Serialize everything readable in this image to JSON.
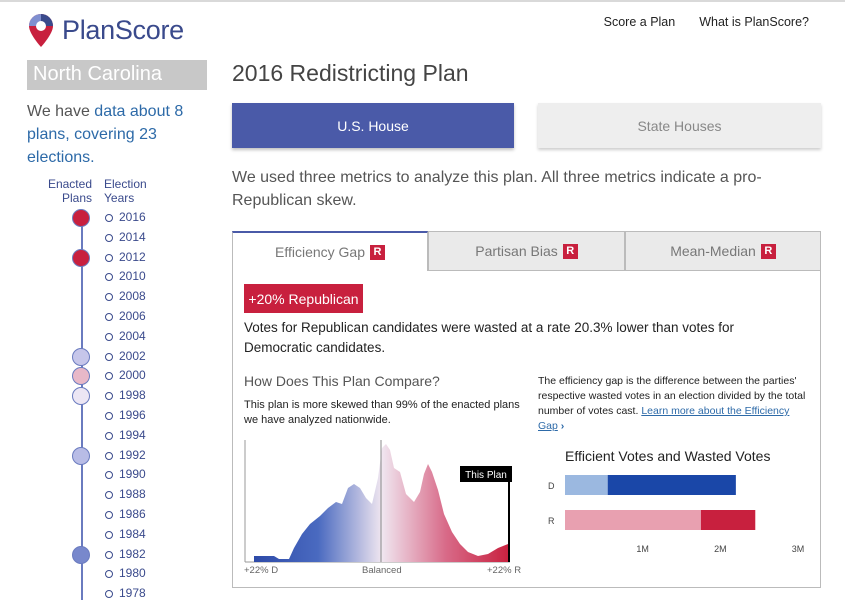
{
  "header": {
    "brand": "PlanScore",
    "nav": [
      "Score a Plan",
      "What is PlanScore?"
    ]
  },
  "sidebar": {
    "state": "North Carolina",
    "summary": {
      "prefix": "We have ",
      "link": "data about 8 plans, covering 23 elections.",
      "suffix": ""
    },
    "col_enacted": [
      "Enacted",
      "Plans"
    ],
    "col_years": [
      "Election",
      "Years"
    ],
    "years": [
      "2016",
      "2014",
      "2012",
      "2010",
      "2008",
      "2006",
      "2004",
      "2002",
      "2000",
      "1998",
      "1996",
      "1994",
      "1992",
      "1990",
      "1988",
      "1986",
      "1984",
      "1982",
      "1980",
      "1978"
    ],
    "enacted": [
      {
        "year": "2016",
        "color": "#c8203e"
      },
      {
        "year": "2012",
        "color": "#c8203e"
      },
      {
        "year": "2002",
        "color": "#c6c6ea"
      },
      {
        "year": "2000",
        "color": "#e8b8c8"
      },
      {
        "year": "1998",
        "color": "#ece6f4"
      },
      {
        "year": "1992",
        "color": "#b8bce6"
      },
      {
        "year": "1982",
        "color": "#7888cc"
      }
    ]
  },
  "main": {
    "title": "2016 Redistricting Plan",
    "buttons": {
      "house": "U.S. House",
      "state": "State Houses"
    },
    "intro": "We used three metrics to analyze this plan. All three metrics indicate a pro-Republican skew.",
    "tabs": [
      {
        "label": "Efficiency Gap",
        "badge": "R"
      },
      {
        "label": "Partisan Bias",
        "badge": "R"
      },
      {
        "label": "Mean-Median",
        "badge": "R"
      }
    ],
    "result_badge": "+20% Republican",
    "result_text": "Votes for Republican candidates were wasted at a rate 20.3% lower than votes for Democratic candidates.",
    "compare_heading": "How Does This Plan Compare?",
    "compare_text": "This plan is more skewed than 99% of the enacted plans we have analyzed nationwide.",
    "explain_text": "The efficiency gap is the difference between the parties' respective wasted votes in an election divided by the total number of votes cast. ",
    "explain_link": "Learn more about the Efficiency Gap",
    "explain_chevron": "›",
    "distribution": {
      "marker_label": "This Plan",
      "axis_left": "+22% D",
      "axis_center": "Balanced",
      "axis_right": "+22% R"
    },
    "colors": {
      "republican": "#c8203e",
      "democrat": "#1a47a8",
      "accent": "#4a5aa8"
    }
  },
  "chart_data": {
    "type": "bar",
    "title": "Efficient Votes and Wasted Votes",
    "categories": [
      "D",
      "R"
    ],
    "series": [
      {
        "values": [
          0.55,
          1.75
        ]
      },
      {
        "values": [
          1.65,
          0.7
        ]
      }
    ],
    "xlim": [
      0,
      3
    ],
    "xticks": [
      "1M",
      "2M",
      "3M"
    ],
    "xtick_values": [
      1,
      2,
      3
    ],
    "colors": {
      "D": [
        "#9bb8e0",
        "#1a47a8"
      ],
      "R": [
        "#e8a0b0",
        "#c8203e"
      ]
    },
    "orientation": "horizontal",
    "stacked": true
  }
}
